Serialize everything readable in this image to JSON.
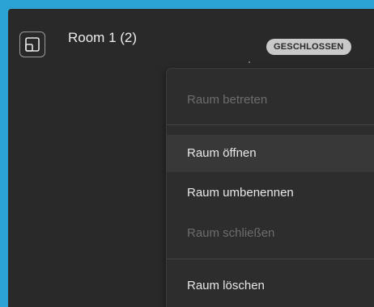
{
  "room": {
    "title": "Room 1 (2)",
    "status": "GESCHLOSSEN",
    "icon": "room-window-icon"
  },
  "menu": {
    "items": [
      {
        "label": "Raum betreten",
        "enabled": false
      },
      {
        "label": "Raum öffnen",
        "enabled": true,
        "highlighted": true
      },
      {
        "label": "Raum umbenennen",
        "enabled": true
      },
      {
        "label": "Raum schließen",
        "enabled": false
      },
      {
        "label": "Raum löschen",
        "enabled": true
      }
    ]
  },
  "colors": {
    "background": "#2ba2d4",
    "panel": "#292929",
    "menu": "#2d2d2d",
    "menu_hover": "#383838",
    "badge": "#c9c9c9"
  }
}
